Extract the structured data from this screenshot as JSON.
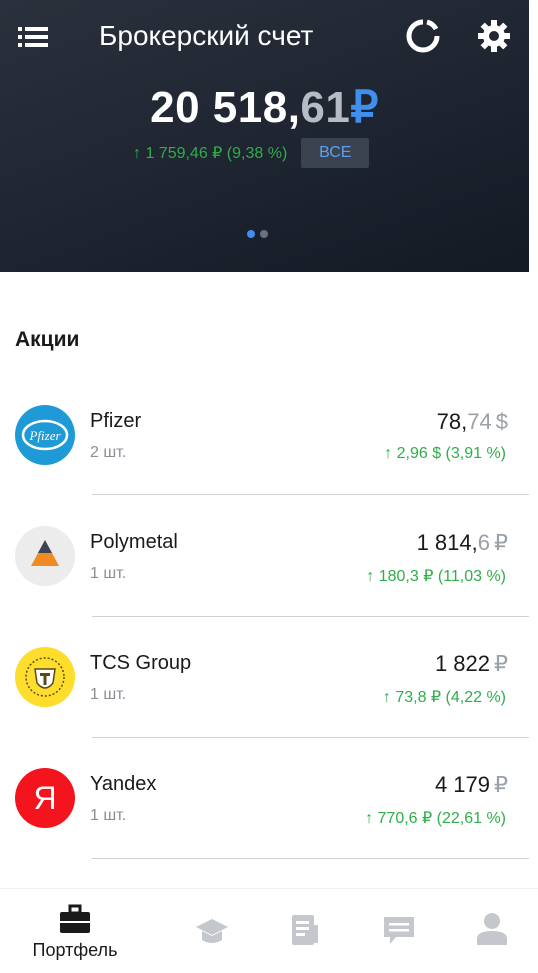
{
  "header": {
    "title": "Брокерский счет",
    "balance_int": "20 518,",
    "balance_frac": "61",
    "balance_currency": "₽",
    "change": "↑ 1 759,46 ₽ (9,38 %)",
    "all_button": "ВСЕ",
    "pager": {
      "count": 2,
      "active": 1
    }
  },
  "section": {
    "title": "Акции"
  },
  "stocks": [
    {
      "name": "Pfizer",
      "qty": "2 шт.",
      "price_int": "78,",
      "price_frac": "74",
      "currency": "$",
      "change": "↑ 2,96 $ (3,91 %)",
      "logo_text": "Pfizer"
    },
    {
      "name": "Polymetal",
      "qty": "1 шт.",
      "price_int": "1 814,",
      "price_frac": "6",
      "currency": "₽",
      "change": "↑ 180,3 ₽ (11,03 %)",
      "logo_text": ""
    },
    {
      "name": "TCS Group",
      "qty": "1 шт.",
      "price_int": "1 822",
      "price_frac": "",
      "currency": "₽",
      "change": "↑ 73,8 ₽ (4,22 %)",
      "logo_text": ""
    },
    {
      "name": "Yandex",
      "qty": "1 шт.",
      "price_int": "4 179",
      "price_frac": "",
      "currency": "₽",
      "change": "↑ 770,6 ₽ (22,61 %)",
      "logo_text": "Я"
    }
  ],
  "nav": {
    "items": [
      {
        "label": "Портфель",
        "icon": "briefcase-icon",
        "active": true
      },
      {
        "label": "",
        "icon": "graduation-cap-icon",
        "active": false
      },
      {
        "label": "",
        "icon": "news-icon",
        "active": false
      },
      {
        "label": "",
        "icon": "chat-icon",
        "active": false
      },
      {
        "label": "",
        "icon": "profile-icon",
        "active": false
      }
    ]
  },
  "colors": {
    "accent": "#3f8ef0",
    "positive": "#2fae4b",
    "header_bg": "#1e2430",
    "muted": "#9aa0a8"
  }
}
